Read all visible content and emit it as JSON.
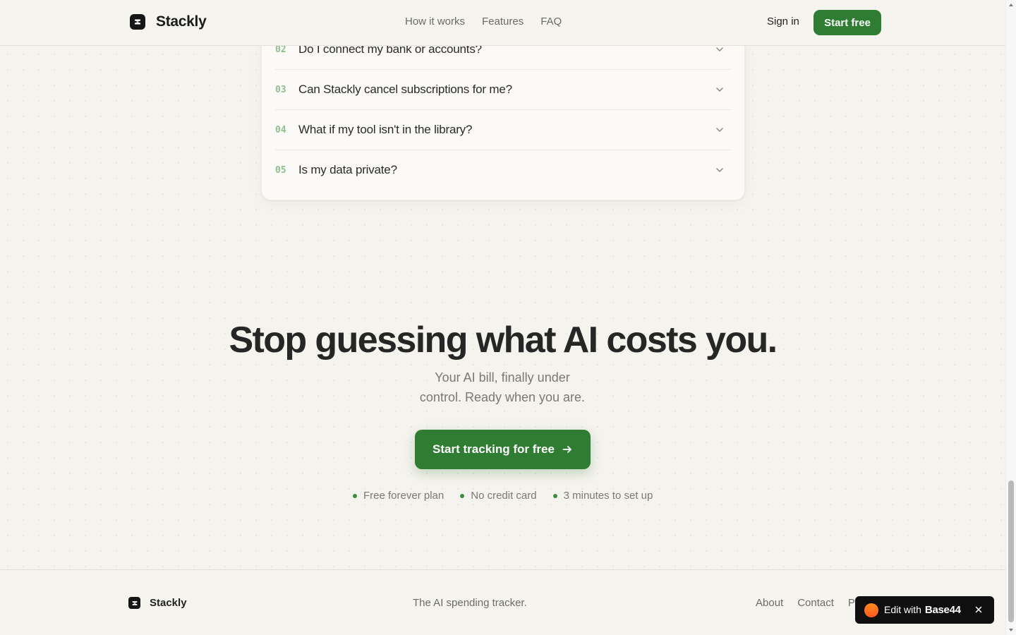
{
  "colors": {
    "accent": "#2e7d32",
    "background": "#f5f3ee",
    "faq_number": "#8fbf90",
    "badge_bg": "#0f0f0f",
    "badge_logo": "#ff6a1f"
  },
  "header": {
    "brand": "Stackly",
    "nav": [
      "How it works",
      "Features",
      "FAQ"
    ],
    "sign_in": "Sign in",
    "start_free": "Start free"
  },
  "faq": {
    "items": [
      {
        "num": "02",
        "question": "Do I connect my bank or accounts?",
        "icon": "chevron-down-icon"
      },
      {
        "num": "03",
        "question": "Can Stackly cancel subscriptions for me?",
        "icon": "chevron-down-icon"
      },
      {
        "num": "04",
        "question": "What if my tool isn't in the library?",
        "icon": "chevron-down-icon"
      },
      {
        "num": "05",
        "question": "Is my data private?",
        "icon": "chevron-down-icon"
      }
    ]
  },
  "cta": {
    "title": "Stop guessing what AI costs you.",
    "subtitle_line1": "Your AI bill, finally under",
    "subtitle_line2": "control. Ready when you are.",
    "button": "Start tracking for free",
    "button_icon": "arrow-right-icon",
    "features": [
      "Free forever plan",
      "No credit card",
      "3 minutes to set up"
    ]
  },
  "footer": {
    "brand": "Stackly",
    "tagline": "The AI spending tracker.",
    "links": [
      "About",
      "Contact",
      "P"
    ]
  },
  "edit_badge": {
    "prefix": "Edit with",
    "brand": "Base44",
    "close_icon": "close-icon"
  }
}
